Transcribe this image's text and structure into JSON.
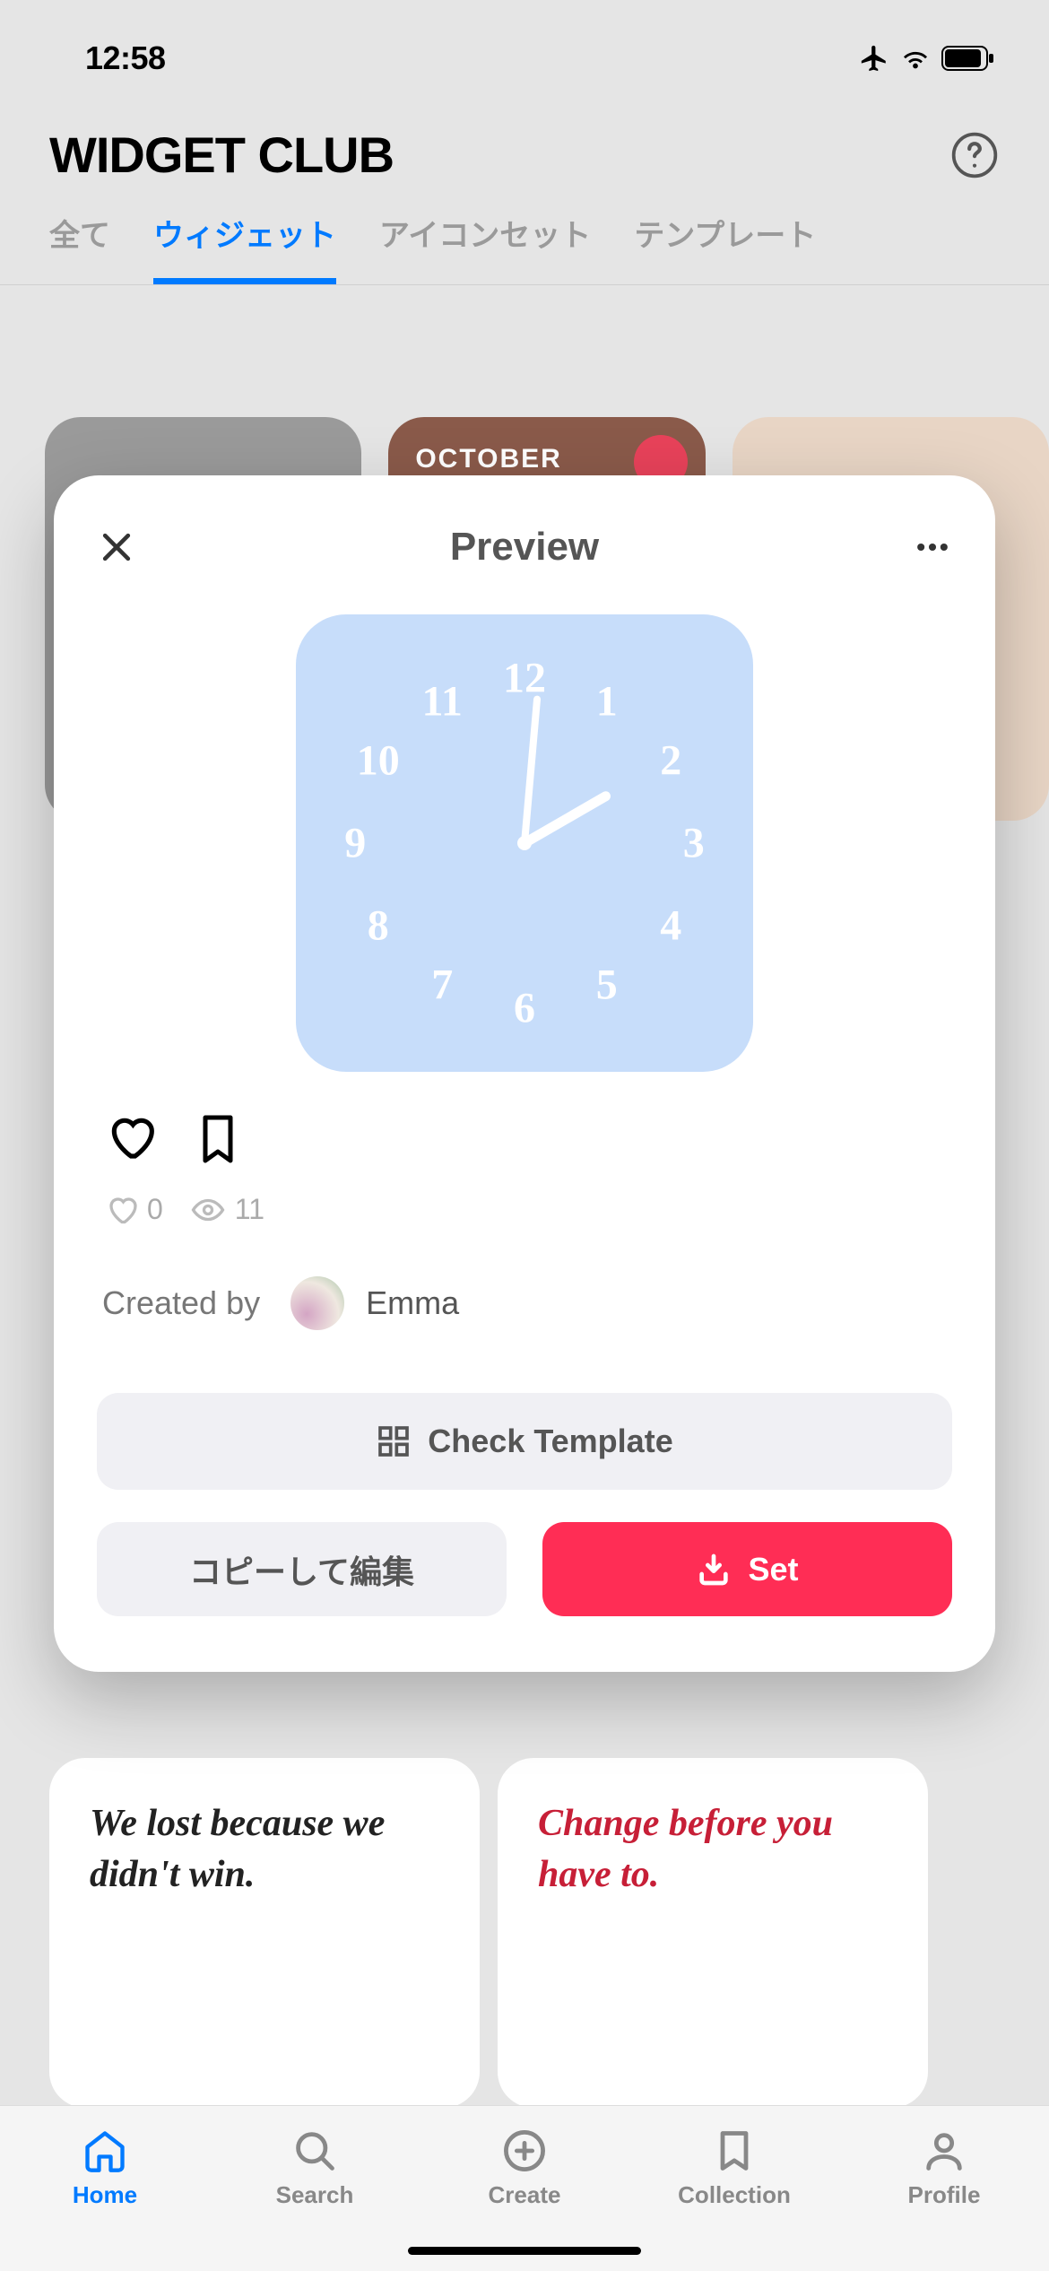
{
  "status": {
    "time": "12:58"
  },
  "header": {
    "title": "WIDGET CLUB"
  },
  "tabs": {
    "all": "全て",
    "widget": "ウィジェット",
    "icon_set": "アイコンセット",
    "template": "テンプレート"
  },
  "modal": {
    "title": "Preview",
    "likes": "0",
    "views": "11",
    "created_by": "Created by",
    "creator": "Emma",
    "check_template": "Check Template",
    "copy_edit": "コピーして編集",
    "set": "Set"
  },
  "nav": {
    "home": "Home",
    "search": "Search",
    "create": "Create",
    "collection": "Collection",
    "profile": "Profile"
  },
  "bg": {
    "quote1": "We lost because we didn't win.",
    "quote2": "Change before you have to.",
    "october": "OCTOBER"
  }
}
